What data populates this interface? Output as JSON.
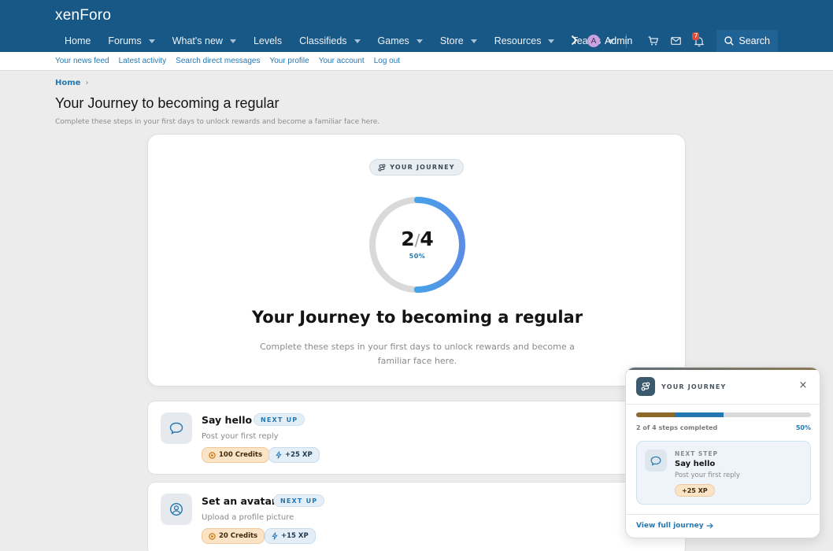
{
  "header": {
    "logo": "xenForo",
    "nav": [
      {
        "label": "Home",
        "caret": false
      },
      {
        "label": "Forums",
        "caret": true
      },
      {
        "label": "What's new",
        "caret": true
      },
      {
        "label": "Levels",
        "caret": false
      },
      {
        "label": "Classifieds",
        "caret": true
      },
      {
        "label": "Games",
        "caret": true
      },
      {
        "label": "Store",
        "caret": true
      },
      {
        "label": "Resources",
        "caret": true
      },
      {
        "label": "Teams",
        "caret": true
      }
    ],
    "user": {
      "avatar_letter": "A",
      "name": "Admin"
    },
    "alerts_count": "7",
    "search_label": "Search"
  },
  "subnav": [
    "Your news feed",
    "Latest activity",
    "Search direct messages",
    "Your profile",
    "Your account",
    "Log out"
  ],
  "breadcrumb": {
    "home": "Home",
    "sep": "›"
  },
  "page": {
    "title": "Your Journey to becoming a regular",
    "description": "Complete these steps in your first days to unlock rewards and become a familiar face here."
  },
  "hero": {
    "pill": "YOUR JOURNEY",
    "completed": "2",
    "total": "4",
    "percent_label": "50%",
    "progress": 0.5,
    "title": "Your Journey to becoming a regular",
    "description": "Complete these steps in your first days to unlock rewards and become a familiar face here."
  },
  "steps": [
    {
      "title": "Say hello",
      "status": "NEXT UP",
      "description": "Post your first reply",
      "credits": "100 Credits",
      "xp": "+25 XP"
    },
    {
      "title": "Set an avatar",
      "status": "NEXT UP",
      "description": "Upload a profile picture",
      "credits": "20 Credits",
      "xp": "+15 XP"
    }
  ],
  "widget": {
    "title": "YOUR JOURNEY",
    "close": "×",
    "progress_label": "2 of 4 steps completed",
    "progress_pct": "50%",
    "progress": 0.5,
    "next_label": "NEXT STEP",
    "next_title": "Say hello",
    "next_desc": "Post your first reply",
    "next_xp": "+25 XP",
    "link": "View full journey"
  },
  "colors": {
    "header": "#185886",
    "accent": "#2577b1",
    "ring_start": "#5b8ee6",
    "ring_end": "#2fb5e8",
    "credits_bg": "#fbe3c6"
  }
}
